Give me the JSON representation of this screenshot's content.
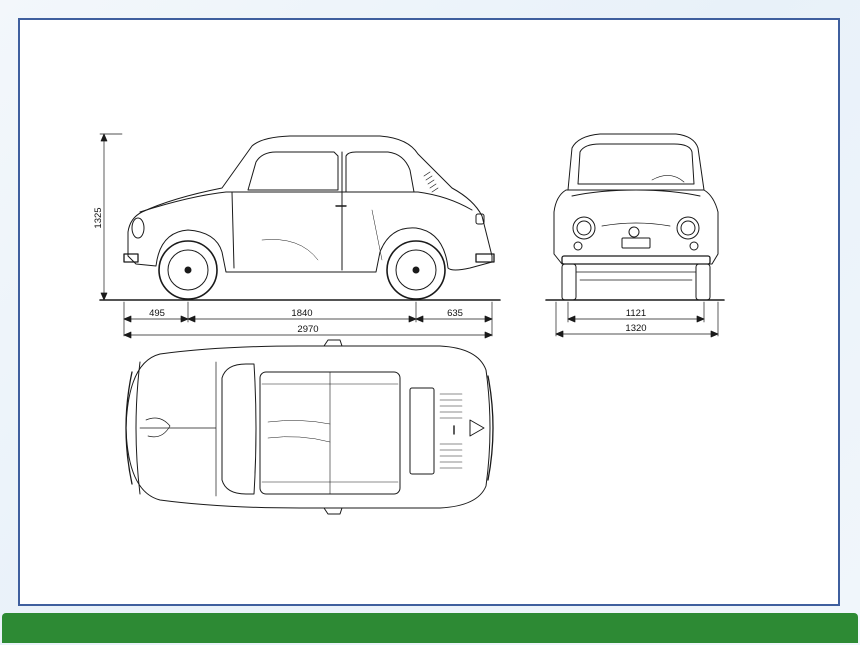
{
  "colors": {
    "frame_border": "#3f5f9e",
    "bottom_bar": "#2d8a34",
    "line": "#1a1a1a"
  },
  "dimensions": {
    "height": "1325",
    "front_overhang": "495",
    "wheelbase": "1840",
    "rear_overhang": "635",
    "overall_length": "2970",
    "track": "1121",
    "overall_width": "1320"
  }
}
